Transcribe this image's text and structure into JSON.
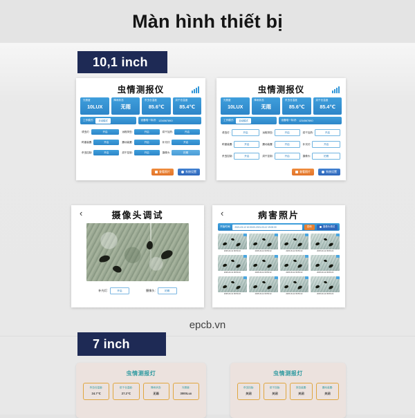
{
  "page": {
    "title": "Màn hình thiết bị",
    "watermark": "epcb.vn"
  },
  "sections": {
    "tag_10_1": "10,1 inch",
    "tag_7": "7 inch"
  },
  "dashboard": {
    "title": "虫情测报仪",
    "signal_icon": "signal-bars-icon",
    "stats": [
      {
        "label": "光照度",
        "value": "10LUX"
      },
      {
        "label": "降雨状态",
        "value": "无雨"
      },
      {
        "label": "杀虫仓温度",
        "value": "85.6℃"
      },
      {
        "label": "烘干仓温度",
        "value": "85.4℃"
      }
    ],
    "mode_label": "工作模式:",
    "mode_value": "手动模式",
    "mode_value_alt": "自动模式",
    "device_code_label": "设备唯一标识:",
    "device_code_value": "123456789O",
    "controls": [
      {
        "label": "诱虫灯:",
        "value": "开启"
      },
      {
        "label": "远程排虫:",
        "value": "开启"
      },
      {
        "label": "烘干加热:",
        "value": "开启"
      },
      {
        "label": "称重装置:",
        "value": "开启"
      },
      {
        "label": "震动装置:",
        "value": "开启"
      },
      {
        "label": "补光灯:",
        "value": "开启"
      },
      {
        "label": "杀虫控制:",
        "value": "开启"
      },
      {
        "label": "烘干控制:",
        "value": "开启"
      },
      {
        "label": "摄像头:",
        "value": "拍照"
      }
    ],
    "footer_buttons": [
      {
        "label": "查看照片",
        "icon": "photo-icon",
        "color": "#e2742a"
      },
      {
        "label": "系统设置",
        "icon": "gear-icon",
        "color": "#2f67bb"
      }
    ]
  },
  "camera": {
    "title": "摄像头调试",
    "back_icon": "chevron-left-icon",
    "controls": [
      {
        "label": "补光灯:",
        "value": "开启"
      },
      {
        "label": "摄像头:",
        "value": "拍照"
      }
    ]
  },
  "gallery": {
    "title": "病害照片",
    "back_icon": "chevron-left-icon",
    "range_label": "开始时间:",
    "range_value": "2021-03-12 10:00:00-2021-03-12 19:00:00",
    "query_button": "查询",
    "debug_button": "摄像头调试",
    "debug_icon": "camera-icon",
    "thumbs": [
      {
        "caption": "2025-03-12 09:50:22"
      },
      {
        "caption": "2025-03-12 09:50:22"
      },
      {
        "caption": "2025-03-12 09:50:22"
      },
      {
        "caption": "2025-03-12 09:50:22"
      },
      {
        "caption": "2025-03-12 09:50:22"
      },
      {
        "caption": "2025-03-12 09:50:22"
      },
      {
        "caption": "2025-03-12 09:50:22"
      },
      {
        "caption": "2025-03-12 09:50:22"
      },
      {
        "caption": "2025-03-12 09:50:22"
      },
      {
        "caption": "2025-03-12 09:50:22"
      },
      {
        "caption": "2025-03-12 09:50:22"
      },
      {
        "caption": "2025-03-12 09:50:22"
      }
    ]
  },
  "lamp_left": {
    "title": "虫情测报灯",
    "cells": [
      {
        "label": "杀虫仓温度:",
        "value": "24.7℃"
      },
      {
        "label": "烘干仓温度:",
        "value": "27.2℃"
      },
      {
        "label": "降雨状态:",
        "value": "无雨"
      },
      {
        "label": "光照度:",
        "value": "3000Lux"
      }
    ]
  },
  "lamp_right": {
    "title": "虫情测报灯",
    "cells": [
      {
        "label": "杀虫挡板:",
        "value": "关闭"
      },
      {
        "label": "烘干挡板:",
        "value": "关闭"
      },
      {
        "label": "排虫装置:",
        "value": "关闭"
      },
      {
        "label": "震动装置:",
        "value": "关闭"
      }
    ]
  },
  "colors": {
    "accent_blue": "#2d86c8",
    "navy_tag": "#1e2a55",
    "orange": "#e2742a",
    "teal": "#2f9aa0",
    "amber_border": "#e0a63e",
    "page_bg": "#e7e7e7"
  }
}
